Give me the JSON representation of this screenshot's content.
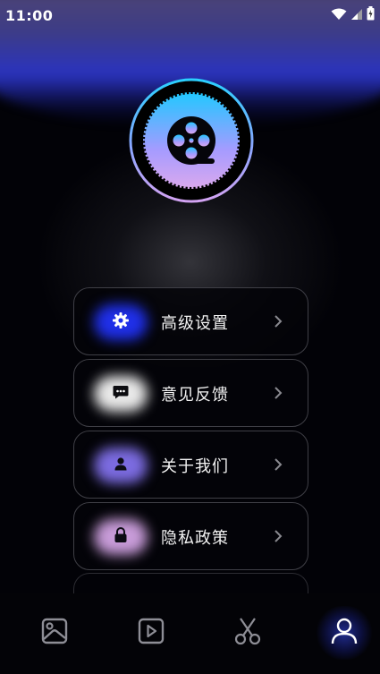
{
  "status_bar": {
    "time": "11:00",
    "icons": [
      "wifi-icon",
      "cell-signal-icon",
      "battery-icon"
    ]
  },
  "logo": {
    "icon": "film-reel-icon"
  },
  "menu": {
    "items": [
      {
        "label": "高级设置",
        "icon": "gear-icon",
        "glow": "#1f2fe8"
      },
      {
        "label": "意见反馈",
        "icon": "chat-icon",
        "glow": "#e8e8e8"
      },
      {
        "label": "关于我们",
        "icon": "person-icon",
        "glow": "#7b6be0"
      },
      {
        "label": "隐私政策",
        "icon": "lock-icon",
        "glow": "#c79bd8"
      }
    ]
  },
  "bottom_nav": {
    "items": [
      {
        "icon": "image-icon",
        "active": false
      },
      {
        "icon": "video-play-icon",
        "active": false
      },
      {
        "icon": "scissors-icon",
        "active": false
      },
      {
        "icon": "person-icon",
        "active": true
      }
    ]
  },
  "colors": {
    "background": "#020207",
    "accent": "#2a33c0",
    "logo_gradient_start": "#2ad0ff",
    "logo_gradient_end": "#d3a3f2"
  }
}
